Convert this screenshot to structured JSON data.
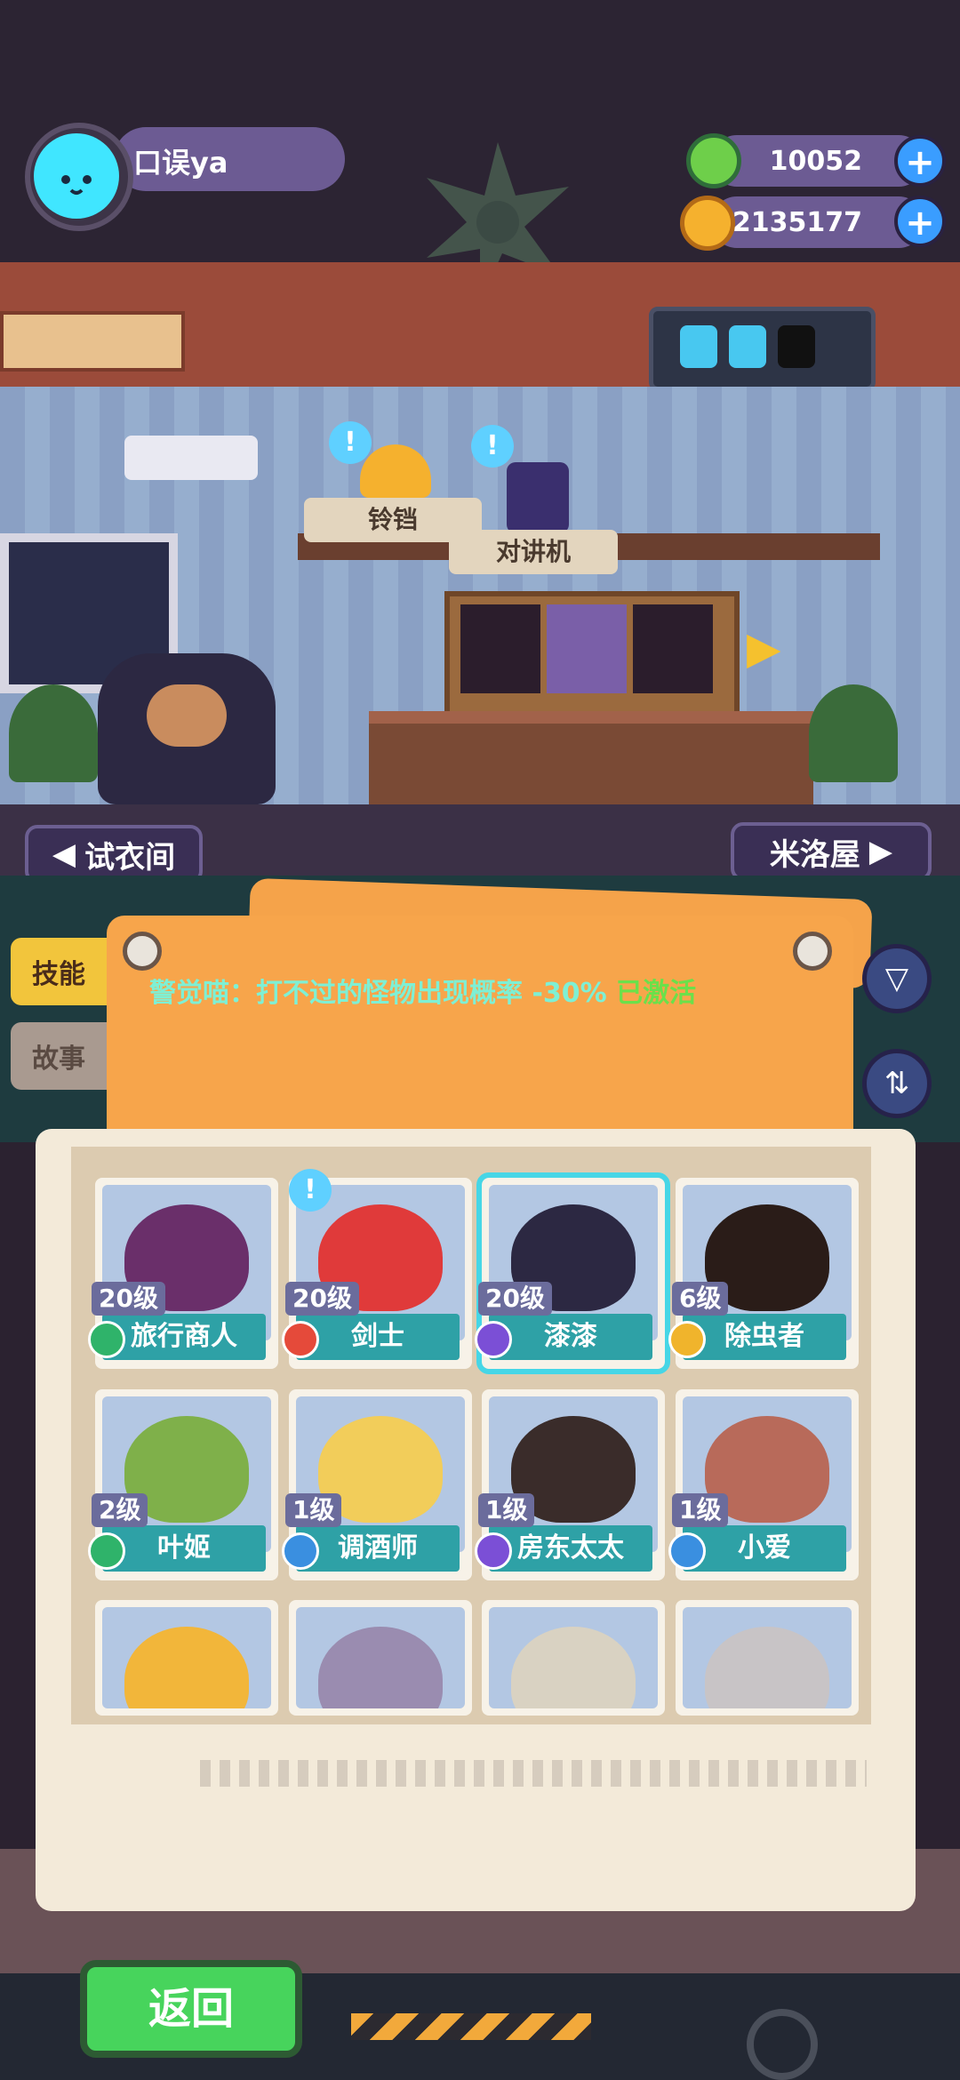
{
  "player": {
    "name": "口误ya"
  },
  "resources": [
    {
      "icon": "green-gem-icon",
      "amount": "10052"
    },
    {
      "icon": "gold-coin-icon",
      "amount": "2135177"
    }
  ],
  "room": {
    "bell_label": "铃铛",
    "walkie_label": "对讲机",
    "left_room_button": "试衣间",
    "right_room_button": "米洛屋"
  },
  "side_tabs": [
    {
      "label": "技能",
      "active": true
    },
    {
      "label": "故事",
      "active": false
    }
  ],
  "skill": {
    "text": "警觉喵：打不过的怪物出现概率 -30%",
    "status": "已激活"
  },
  "characters": [
    {
      "level": "20级",
      "name": "旅行商人",
      "rarity_color": "#2fb36a"
    },
    {
      "level": "20级",
      "name": "剑士",
      "rarity_color": "#e54a3a"
    },
    {
      "level": "20级",
      "name": "漆漆",
      "rarity_color": "#7b4fd6"
    },
    {
      "level": "6级",
      "name": "除虫者",
      "rarity_color": "#f0b42c"
    },
    {
      "level": "2级",
      "name": "叶姬",
      "rarity_color": "#2fb36a"
    },
    {
      "level": "1级",
      "name": "调酒师",
      "rarity_color": "#3a8fe0"
    },
    {
      "level": "1级",
      "name": "房东太太",
      "rarity_color": "#7b4fd6"
    },
    {
      "level": "1级",
      "name": "小爱",
      "rarity_color": "#3a8fe0"
    }
  ],
  "back_button": "返回",
  "colors": {
    "accent_cyan": "#40e6ff",
    "orange_panel": "#f7a54b",
    "green_button": "#47d45c"
  }
}
